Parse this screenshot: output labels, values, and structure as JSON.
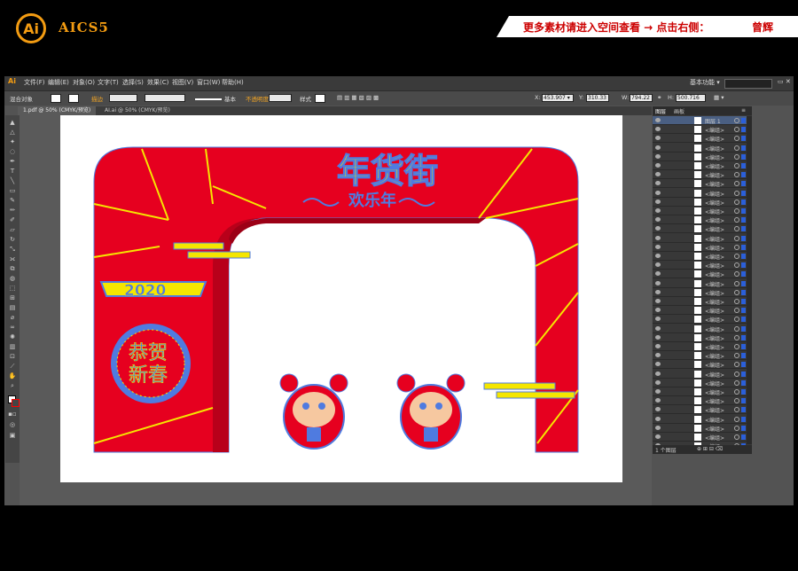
{
  "banner": {
    "logo": "Ai",
    "version": "AICS5",
    "promo_text": "更多素材请进入空间查看 → 点击右侧：",
    "promo_author": "曾辉"
  },
  "menubar": {
    "app_icon": "Ai",
    "items": [
      "文件(F)",
      "编辑(E)",
      "对象(O)",
      "文字(T)",
      "选择(S)",
      "效果(C)",
      "视图(V)",
      "窗口(W)",
      "帮助(H)"
    ],
    "workspace": "基本功能 ▾"
  },
  "controlbar": {
    "object_label": "混合对象",
    "stroke_label": "描边",
    "stroke_style": "基本",
    "opacity_label": "不透明度",
    "style_label": "样式",
    "x_label": "X:",
    "x_value": "453.907 ▾",
    "y_label": "Y:",
    "y_value": "310.33",
    "w_label": "W:",
    "w_value": "794.22",
    "h_label": "H:",
    "h_value": "500.716"
  },
  "tabs": [
    "1.pdf @ 50% (CMYK/预览)",
    "AI.ai @ 50% (CMYK/预览)"
  ],
  "layers_panel": {
    "tabs": [
      "图层",
      "画板"
    ],
    "top_layer": "图层 1",
    "rows": [
      "<编组>",
      "<编组>",
      "<编组>",
      "<编组>",
      "<编组>",
      "<编组>",
      "<编组>",
      "<编组>",
      "<编组>",
      "<编组>",
      "<编组>",
      "<编组>",
      "<编组>",
      "<编组>",
      "<编组>",
      "<编组>",
      "<编组>",
      "<编组>",
      "<编组>",
      "<编组>",
      "<编组>",
      "<编组>",
      "<编组>",
      "<编组>",
      "<编组>",
      "<编组>",
      "<编组>",
      "<编组>",
      "<编组>",
      "<编组>",
      "<编组>",
      "<编组>",
      "<编组>",
      "<编组>",
      "<编组>",
      "<编组>"
    ],
    "footer": "1 个图层"
  },
  "artwork": {
    "headline": "年货街",
    "sub": "欢乐年",
    "year": "2020",
    "blessing_1": "恭贺",
    "blessing_2": "新春",
    "colors": {
      "red": "#e6001f",
      "yellow": "#f5e600",
      "blue": "#4f7be0"
    }
  }
}
